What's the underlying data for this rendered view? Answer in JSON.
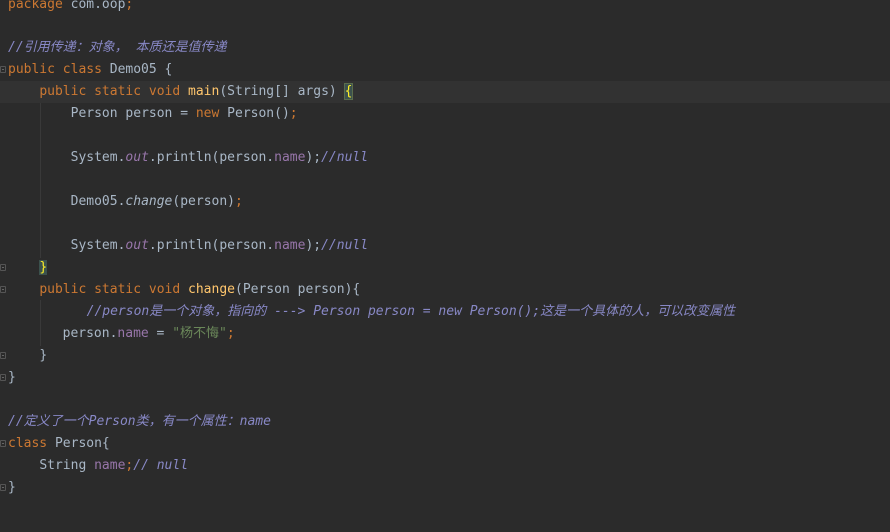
{
  "editor": {
    "line_package": {
      "kw": "package",
      "name": " com.oop",
      "semi": ";"
    },
    "line_comment1": "//引用传递：对象， 本质还是值传递",
    "line_class_demo": {
      "mod": "public class",
      "name": " Demo05 ",
      "brace": "{"
    },
    "line_main": {
      "indent": "    ",
      "mods": "public static void",
      "sp": " ",
      "fn": "main",
      "sig": "(String[] args) ",
      "brace": "{"
    },
    "line_new_person": {
      "indent": "        ",
      "type": "Person person = ",
      "new": "new",
      "rest": " Person()",
      "semi": ";"
    },
    "line_print1": {
      "indent": "        ",
      "sys": "System.",
      "out": "out",
      "call": ".println(person.",
      "field": "name",
      "close": ");",
      "comment": "//null"
    },
    "line_change_call": {
      "indent": "        ",
      "cls": "Demo05.",
      "method": "change",
      "args": "(person)",
      "semi": ";"
    },
    "line_print2": {
      "indent": "        ",
      "sys": "System.",
      "out": "out",
      "call": ".println(person.",
      "field": "name",
      "close": ");",
      "comment": "//null"
    },
    "line_main_close": {
      "indent": "    ",
      "brace": "}"
    },
    "line_change_decl": {
      "indent": "    ",
      "mods": "public static void",
      "sp": " ",
      "fn": "change",
      "sig": "(Person person){"
    },
    "line_comment2": {
      "indent": "        ",
      "text": "//person是一个对象，指向的 ---> Person person = new Person();这是一个具体的人，可以改变属性"
    },
    "line_assign": {
      "indent": "        ",
      "pre": "person.",
      "field": "name",
      "eq": " = ",
      "str": "\"杨不悔\"",
      "semi": ";"
    },
    "line_change_close": {
      "indent": "    ",
      "brace": "}"
    },
    "line_class_close": "}",
    "line_comment3": "//定义了一个Person类，有一个属性：name",
    "line_class_person": {
      "kw": "class",
      "rest": " Person{"
    },
    "line_field": {
      "indent": "    ",
      "type": "String ",
      "field": "name",
      "semi": ";",
      "comment": "// null"
    },
    "line_person_close": "}"
  },
  "colors": {
    "background": "#2b2b2b",
    "keyword": "#cc7832",
    "comment": "#8888c6",
    "function": "#ffc66d",
    "field": "#9876aa",
    "string": "#6a8759",
    "text": "#a9b7c6"
  }
}
